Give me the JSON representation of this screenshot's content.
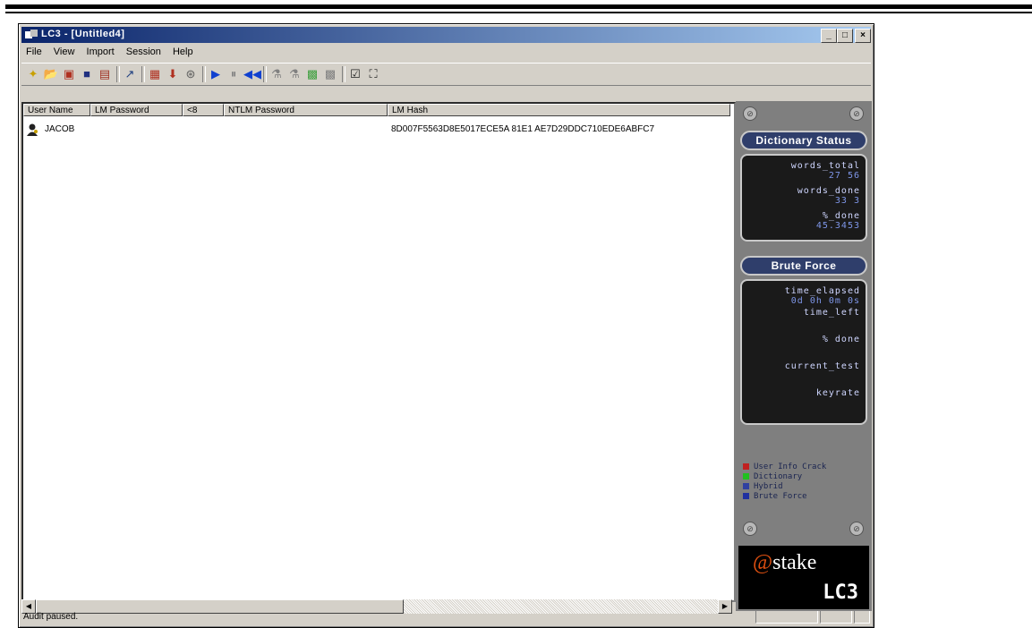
{
  "window": {
    "title": "LC3 - [Untitled4]"
  },
  "menu": [
    "File",
    "View",
    "Import",
    "Session",
    "Help"
  ],
  "toolbar": [
    {
      "name": "new-session-icon",
      "glyph": "✦",
      "color": "#c8a000"
    },
    {
      "name": "open-session-icon",
      "glyph": "📂",
      "color": "#c8a000"
    },
    {
      "name": "import-icon",
      "glyph": "▣",
      "color": "#b03020"
    },
    {
      "name": "save-icon",
      "glyph": "■",
      "color": "#203080"
    },
    {
      "name": "export-icon",
      "glyph": "▤",
      "color": "#a03020"
    },
    {
      "name": "sep"
    },
    {
      "name": "password-icon",
      "glyph": "↗",
      "color": "#204080"
    },
    {
      "name": "sep"
    },
    {
      "name": "report-icon",
      "glyph": "▦",
      "color": "#b03020"
    },
    {
      "name": "pin-icon",
      "glyph": "⬇",
      "color": "#b03020"
    },
    {
      "name": "options-icon",
      "glyph": "⊛",
      "color": "#606060"
    },
    {
      "name": "sep"
    },
    {
      "name": "play-icon",
      "glyph": "▶",
      "color": "#1040d0"
    },
    {
      "name": "pause-icon",
      "glyph": "⏸",
      "color": "#7f7f7f"
    },
    {
      "name": "rewind-icon",
      "glyph": "◀◀",
      "color": "#1040d0"
    },
    {
      "name": "sep"
    },
    {
      "name": "filter-icon",
      "glyph": "⚗",
      "color": "#808080"
    },
    {
      "name": "filter2-icon",
      "glyph": "⚗",
      "color": "#808080"
    },
    {
      "name": "hash-icon",
      "glyph": "▩",
      "color": "#40a040"
    },
    {
      "name": "grid-icon",
      "glyph": "▩",
      "color": "#808080"
    },
    {
      "name": "sep"
    },
    {
      "name": "properties-icon",
      "glyph": "☑",
      "color": "#202020"
    },
    {
      "name": "fullscreen-icon",
      "glyph": "⛶",
      "color": "#202020"
    }
  ],
  "columns": [
    "User Name",
    "LM Password",
    "<8",
    "NTLM Password",
    "LM Hash"
  ],
  "rows": [
    {
      "user": "JACOB",
      "lm_password": "",
      "lt8": "",
      "ntlm_password": "",
      "lm_hash": "8D007F5563D8E5017ECE5A 81E1 AE7D29DDC710EDE6ABFC7"
    }
  ],
  "status_text": "Audit paused.",
  "side_panel": {
    "dictionary_status_label": "Dictionary Status",
    "dictionary": [
      {
        "label": "words_total",
        "value": "27 56"
      },
      {
        "label": "words_done",
        "value": "33 3"
      },
      {
        "label": "%_done",
        "value": "45.3453"
      }
    ],
    "brute_force_label": "Brute Force",
    "brute": [
      {
        "label": "time_elapsed",
        "value": "0d 0h 0m 0s"
      },
      {
        "label": "time_left",
        "value": ""
      },
      {
        "label": "% done",
        "value": ""
      },
      {
        "label": "current_test",
        "value": ""
      },
      {
        "label": "keyrate",
        "value": ""
      }
    ],
    "legend": [
      {
        "label": "User Info Crack",
        "color": "#c02020"
      },
      {
        "label": "Dictionary",
        "color": "#20c020"
      },
      {
        "label": "Hybrid",
        "color": "#3040a0"
      },
      {
        "label": "Brute Force",
        "color": "#2030a0"
      }
    ],
    "brand_at": "@stake",
    "brand_product": "LC3"
  }
}
